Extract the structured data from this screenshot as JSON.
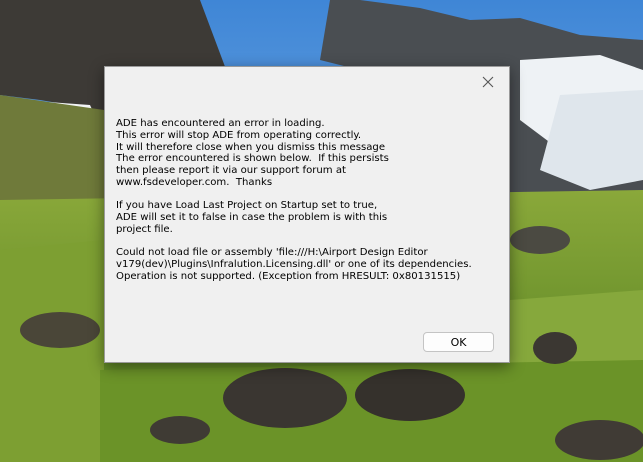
{
  "dialog": {
    "paragraphs": [
      "ADE has encountered an error in loading.\nThis error will stop ADE from operating correctly.\nIt will therefore close when you dismiss this message\nThe error encountered is shown below.  If this persists\nthen please report it via our support forum at\nwww.fsdeveloper.com.  Thanks",
      "If you have Load Last Project on Startup set to true,\nADE will set it to false in case the problem is with this\nproject file.",
      "Could not load file or assembly 'file:///H:\\Airport Design Editor\nv179(dev)\\Plugins\\Infralution.Licensing.dll' or one of its dependencies.\nOperation is not supported. (Exception from HRESULT: 0x80131515)"
    ],
    "ok_label": "OK",
    "close_icon": "close-icon"
  },
  "colors": {
    "dialog_bg": "#f0f0f0",
    "button_bg": "#fdfdfd",
    "sky": "#5a9ad6",
    "grass": "#6e9a2a"
  }
}
